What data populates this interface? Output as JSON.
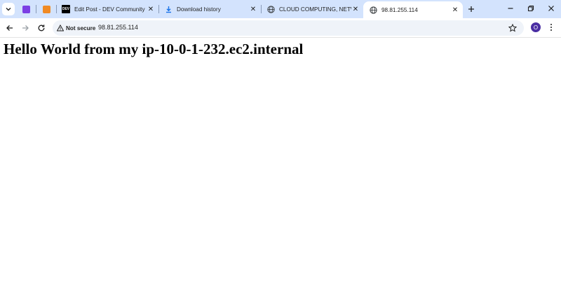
{
  "tabs": [
    {
      "label": "Edit Post - DEV Community",
      "icon": "dev-logo-icon"
    },
    {
      "label": "Download history",
      "icon": "download-icon"
    },
    {
      "label": "CLOUD COMPUTING, NETWO",
      "icon": "globe-icon"
    },
    {
      "label": "98.81.255.114",
      "icon": "globe-icon",
      "active": true
    }
  ],
  "pinned_tabs": [
    {
      "icon": "purple-app-icon",
      "color": "#7b3fe4"
    },
    {
      "icon": "orange-app-icon",
      "color": "#f08a24"
    }
  ],
  "dev_logo_text": "DEV",
  "toolbar": {
    "security_label": "Not secure",
    "url": "98.81.255.114",
    "avatar_letter": "O"
  },
  "page": {
    "heading": "Hello World from my ip-10-0-1-232.ec2.internal"
  },
  "colors": {
    "tabstrip": "#d3e3fd",
    "omnibox": "#eff3f9",
    "download_icon": "#1a73e8",
    "avatar": "#4b2fa3"
  }
}
